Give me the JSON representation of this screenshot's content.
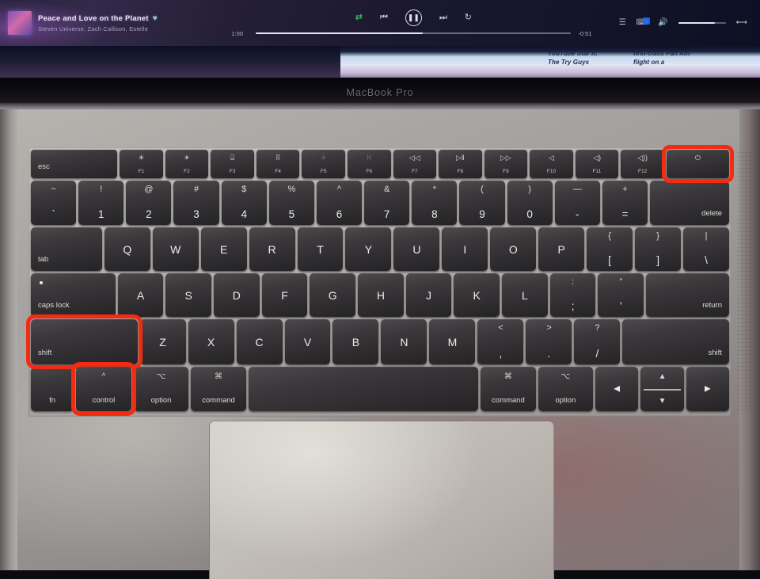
{
  "screen": {
    "player": {
      "now_playing": {
        "title": "Peace and Love on the Planet",
        "artists": "Steven Universe, Zach Callison, Estelle",
        "liked_icon": "heart-icon"
      },
      "controls": {
        "shuffle_icon": "shuffle-icon",
        "previous_icon": "skip-previous-icon",
        "play_pause_icon": "pause-icon",
        "next_icon": "skip-next-icon",
        "repeat_icon": "repeat-icon"
      },
      "progress": {
        "elapsed": "1:00",
        "remaining": "-0:51"
      },
      "right_controls": {
        "queue_icon": "queue-icon",
        "devices_icon": "connect-device-icon",
        "volume_icon": "volume-icon",
        "fullscreen_icon": "fullscreen-icon"
      }
    }
  },
  "browser_strip": {
    "snippet_a": "YouTube Star ft.\nThe Try Guys",
    "snippet_b": "first-class Pan Am\nflight on a"
  },
  "laptop": {
    "lid_logo": "MacBook Pro"
  },
  "highlight_color": "#f32b12",
  "highlighted_keys": [
    "power",
    "shift-left",
    "control"
  ],
  "keyboard": {
    "fn_row": [
      {
        "name": "esc",
        "label": "esc",
        "type": "word-left"
      },
      {
        "name": "f1",
        "icon": "brightness-down-icon",
        "glyph": "☀",
        "label": "F1"
      },
      {
        "name": "f2",
        "icon": "brightness-up-icon",
        "glyph": "☀",
        "label": "F2"
      },
      {
        "name": "f3",
        "icon": "mission-control-icon",
        "glyph": "⌸",
        "label": "F3"
      },
      {
        "name": "f4",
        "icon": "launchpad-icon",
        "glyph": "⠿",
        "label": "F4"
      },
      {
        "name": "f5",
        "icon": "keyboard-brightness-down-icon",
        "glyph": "⁘",
        "label": "F5"
      },
      {
        "name": "f6",
        "icon": "keyboard-brightness-up-icon",
        "glyph": "⁙",
        "label": "F6"
      },
      {
        "name": "f7",
        "icon": "rewind-icon",
        "glyph": "◁◁",
        "label": "F7"
      },
      {
        "name": "f8",
        "icon": "play-pause-icon",
        "glyph": "▷ǁ",
        "label": "F8"
      },
      {
        "name": "f9",
        "icon": "fast-forward-icon",
        "glyph": "▷▷",
        "label": "F9"
      },
      {
        "name": "f10",
        "icon": "mute-icon",
        "glyph": "◁",
        "label": "F10"
      },
      {
        "name": "f11",
        "icon": "volume-down-icon",
        "glyph": "◁)",
        "label": "F11"
      },
      {
        "name": "f12",
        "icon": "volume-up-icon",
        "glyph": "◁))",
        "label": "F12"
      },
      {
        "name": "power",
        "icon": "power-icon",
        "glyph": "⏻",
        "label": ""
      }
    ],
    "number_row": [
      {
        "name": "backtick",
        "top": "~",
        "bottom": "`"
      },
      {
        "name": "1",
        "top": "!",
        "bottom": "1"
      },
      {
        "name": "2",
        "top": "@",
        "bottom": "2"
      },
      {
        "name": "3",
        "top": "#",
        "bottom": "3"
      },
      {
        "name": "4",
        "top": "$",
        "bottom": "4"
      },
      {
        "name": "5",
        "top": "%",
        "bottom": "5"
      },
      {
        "name": "6",
        "top": "^",
        "bottom": "6"
      },
      {
        "name": "7",
        "top": "&",
        "bottom": "7"
      },
      {
        "name": "8",
        "top": "*",
        "bottom": "8"
      },
      {
        "name": "9",
        "top": "(",
        "bottom": "9"
      },
      {
        "name": "0",
        "top": ")",
        "bottom": "0"
      },
      {
        "name": "minus",
        "top": "—",
        "bottom": "-"
      },
      {
        "name": "equal",
        "top": "+",
        "bottom": "="
      },
      {
        "name": "delete",
        "word": "delete"
      }
    ],
    "q_row": [
      {
        "name": "tab",
        "word": "tab"
      },
      {
        "name": "q",
        "letter": "Q"
      },
      {
        "name": "w",
        "letter": "W"
      },
      {
        "name": "e",
        "letter": "E"
      },
      {
        "name": "r",
        "letter": "R"
      },
      {
        "name": "t",
        "letter": "T"
      },
      {
        "name": "y",
        "letter": "Y"
      },
      {
        "name": "u",
        "letter": "U"
      },
      {
        "name": "i",
        "letter": "I"
      },
      {
        "name": "o",
        "letter": "O"
      },
      {
        "name": "p",
        "letter": "P"
      },
      {
        "name": "bracket-left",
        "top": "{",
        "bottom": "["
      },
      {
        "name": "bracket-right",
        "top": "}",
        "bottom": "]"
      },
      {
        "name": "backslash",
        "top": "|",
        "bottom": "\\"
      }
    ],
    "a_row": [
      {
        "name": "caps-lock",
        "word": "caps lock"
      },
      {
        "name": "a",
        "letter": "A"
      },
      {
        "name": "s",
        "letter": "S"
      },
      {
        "name": "d",
        "letter": "D"
      },
      {
        "name": "f",
        "letter": "F"
      },
      {
        "name": "g",
        "letter": "G"
      },
      {
        "name": "h",
        "letter": "H"
      },
      {
        "name": "j",
        "letter": "J"
      },
      {
        "name": "k",
        "letter": "K"
      },
      {
        "name": "l",
        "letter": "L"
      },
      {
        "name": "semicolon",
        "top": ":",
        "bottom": ";"
      },
      {
        "name": "quote",
        "top": "”",
        "bottom": "’"
      },
      {
        "name": "return",
        "word": "return"
      }
    ],
    "z_row": [
      {
        "name": "shift-left",
        "word": "shift"
      },
      {
        "name": "z",
        "letter": "Z"
      },
      {
        "name": "x",
        "letter": "X"
      },
      {
        "name": "c",
        "letter": "C"
      },
      {
        "name": "v",
        "letter": "V"
      },
      {
        "name": "b",
        "letter": "B"
      },
      {
        "name": "n",
        "letter": "N"
      },
      {
        "name": "m",
        "letter": "M"
      },
      {
        "name": "comma",
        "top": "<",
        "bottom": ","
      },
      {
        "name": "period",
        "top": ">",
        "bottom": "."
      },
      {
        "name": "slash",
        "top": "?",
        "bottom": "/"
      },
      {
        "name": "shift-right",
        "word": "shift"
      }
    ],
    "space_row": [
      {
        "name": "fn",
        "word": "fn",
        "sym": ""
      },
      {
        "name": "control",
        "word": "control",
        "sym": "^"
      },
      {
        "name": "option-left",
        "word": "option",
        "sym": "⌥"
      },
      {
        "name": "command-left",
        "word": "command",
        "sym": "⌘"
      },
      {
        "name": "space",
        "word": "",
        "sym": ""
      },
      {
        "name": "command-right",
        "word": "command",
        "sym": "⌘"
      },
      {
        "name": "option-right",
        "word": "option",
        "sym": "⌥"
      },
      {
        "name": "arrow-left",
        "word": "",
        "sym": "◀"
      },
      {
        "name": "arrow-up-down",
        "word": "",
        "sym": "▲▼"
      },
      {
        "name": "arrow-right",
        "word": "",
        "sym": "▶"
      }
    ]
  }
}
